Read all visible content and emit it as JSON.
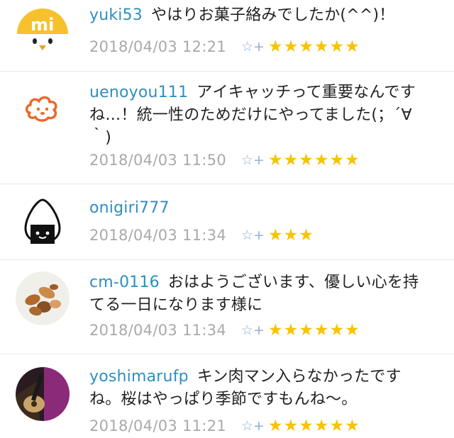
{
  "comments": [
    {
      "user": "yuki53",
      "text": "やはりお菓子絡みでしたか(^^)！",
      "time": "2018/04/03 12:21",
      "stars": "★★★★★★",
      "add_star": "☆+",
      "avatar": "mi-chick-avatar",
      "avatar_text": "mi"
    },
    {
      "user": "uenoyou111",
      "text_line1": "アイキャッチって重要なんです",
      "text_line2": "ね…！統一性のためだけにやってました(；´∀",
      "text_line3": "｀)",
      "time": "2018/04/03 11:50",
      "stars": "★★★★★★",
      "add_star": "☆+",
      "avatar": "orange-cloud-face-avatar"
    },
    {
      "user": "onigiri777",
      "text": "",
      "time": "2018/04/03 11:34",
      "stars": "★★★",
      "add_star": "☆+",
      "avatar": "onigiri-avatar"
    },
    {
      "user": "cm-0116",
      "text_line1": "おはようございます、優しい心を持",
      "text_line2": "てる一日になります様に",
      "time": "2018/04/03 11:34",
      "stars": "★★★★★★",
      "add_star": "☆+",
      "avatar": "mixed-nuts-photo-avatar"
    },
    {
      "user": "yoshimarufp",
      "text_line1": "キン肉マン入らなかったです",
      "text_line2": "ね。桜はやっぱり季節ですもんね～。",
      "time": "2018/04/03 11:21",
      "stars": "★★★★★★",
      "add_star": "☆+",
      "avatar": "guitar-photo-avatar"
    }
  ],
  "colors": {
    "username": "#2f8fc0",
    "star": "#f6c400",
    "add_star": "#8fb0d6",
    "timestamp": "#a9a9a9"
  }
}
